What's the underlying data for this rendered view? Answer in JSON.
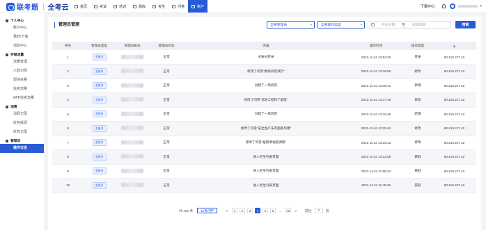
{
  "brand": {
    "name": "联考题",
    "sub": "全考云"
  },
  "nav": [
    {
      "label": "首页",
      "active": false
    },
    {
      "label": "考试",
      "active": false
    },
    {
      "label": "培训",
      "active": false
    },
    {
      "label": "题库",
      "active": false
    },
    {
      "label": "考生",
      "active": false
    },
    {
      "label": "问卷",
      "active": false
    },
    {
      "label": "账户",
      "active": true
    }
  ],
  "topright": {
    "download": "下载中心",
    "caret": "▾"
  },
  "sidebar": {
    "groups": [
      {
        "title": "个人中心",
        "items": [
          "账户中心",
          "我的/下载",
          "消息中心"
        ]
      },
      {
        "title": "存储流量",
        "items": [
          "流量管理",
          "人脸识别",
          "短信余量",
          "监考流量",
          "APP监考流量"
        ]
      },
      {
        "title": "消费",
        "items": [
          "消费记录",
          "红包提现",
          "红包记录"
        ]
      },
      {
        "title": "管理员",
        "items": [
          "操作日志"
        ]
      }
    ],
    "active_item": "操作日志"
  },
  "panel": {
    "title": "管理员管理",
    "filter_admin": "全部管理员",
    "filter_type": "全部操作类型",
    "date_start": "开始日期",
    "date_to": "至",
    "date_end": "结束日期",
    "search": "搜索"
  },
  "table": {
    "headers": [
      "序号",
      "管理员类型",
      "管理员账号",
      "管理员状态",
      "内容",
      "操作时间",
      "操作类型",
      "ip"
    ],
    "rows": [
      {
        "n": "1",
        "type": "主账号",
        "status": "正常",
        "content": "主账号登录",
        "time": "2021-11-24 13:54:20",
        "op": "登录",
        "ip": "60.219.227.42"
      },
      {
        "n": "2",
        "type": "主账号",
        "status": "正常",
        "content": "修改了问卷\"模拟问卷演示\"",
        "time": "2021-11-24 13:38:55",
        "op": "修改",
        "ip": "60.219.227.42"
      },
      {
        "n": "3",
        "type": "主账号",
        "status": "正常",
        "content": "创建了一场问卷",
        "time": "2021-11-24 13:38:41",
        "op": "新增",
        "ip": "60.219.227.42"
      },
      {
        "n": "4",
        "type": "主账号",
        "status": "正常",
        "content": "修改了问卷\"消防工程师了解度\"",
        "time": "2021-11-24 13:17:16",
        "op": "修改",
        "ip": "60.219.227.42"
      },
      {
        "n": "5",
        "type": "主账号",
        "status": "正常",
        "content": "创建了一场问卷",
        "time": "2021-11-24 13:15:45",
        "op": "新增",
        "ip": "60.219.227.42"
      },
      {
        "n": "6",
        "type": "主账号",
        "status": "正常",
        "content": "修改了问卷\"安全生产法考题系列用\"",
        "time": "2021-11-24 13:15:41",
        "op": "修改",
        "ip": "60.219.227.42"
      },
      {
        "n": "7",
        "type": "主账号",
        "status": "正常",
        "content": "修改了问卷\"居民幸福度调研\"",
        "time": "2021-11-24 13:15:13",
        "op": "修改",
        "ip": "60.219.227.42"
      },
      {
        "n": "8",
        "type": "主账号",
        "status": "正常",
        "content": "进入考生列表页面",
        "time": "2021-11-24 13:12:58",
        "op": "获取",
        "ip": "60.219.227.42"
      },
      {
        "n": "9",
        "type": "主账号",
        "status": "正常",
        "content": "进入考生列表页面",
        "time": "2021-11-24 11:56:24",
        "op": "获取",
        "ip": "60.219.227.42"
      },
      {
        "n": "10",
        "type": "主账号",
        "status": "正常",
        "content": "进入考生列表页面",
        "time": "2021-11-24 11:49:49",
        "op": "获取",
        "ip": "60.219.227.42"
      }
    ]
  },
  "pager": {
    "total": "共 400 条",
    "page_size": "10条/页",
    "prev": "<",
    "pages": [
      "1",
      "2",
      "3",
      "4",
      "5",
      "6",
      "...",
      "40"
    ],
    "active": "4",
    "next": ">",
    "goto_label": "前往",
    "goto_value": "4",
    "goto_unit": "页"
  }
}
